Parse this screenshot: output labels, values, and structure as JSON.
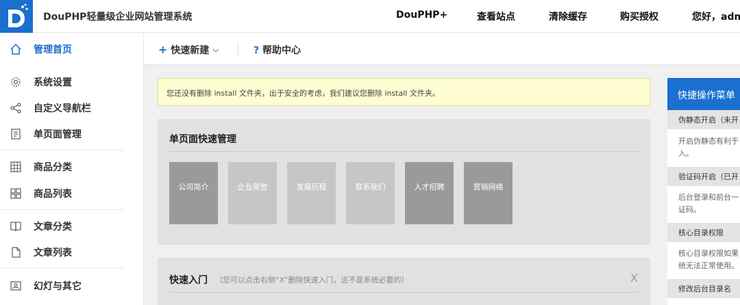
{
  "header": {
    "app_title": "DouPHP轻量级企业网站管理系统",
    "nav": [
      "DouPHP+",
      "查看站点",
      "清除缓存",
      "购买授权"
    ],
    "greeting": "您好，adm"
  },
  "sidebar": {
    "home": "管理首页",
    "items": [
      "系统设置",
      "自定义导航栏",
      "单页面管理",
      "商品分类",
      "商品列表",
      "文章分类",
      "文章列表",
      "幻灯与其它"
    ]
  },
  "toolbar": {
    "quick_new": "快速新建",
    "help": "帮助中心"
  },
  "notice": "您还没有删除 install 文件夹，出于安全的考虑，我们建议您删除 install 文件夹。",
  "single_pages": {
    "title": "单页面快速管理",
    "tiles": [
      "公司简介",
      "企业荣誉",
      "发展历程",
      "联系我们",
      "人才招聘",
      "营销网络"
    ]
  },
  "quick_entry": {
    "title": "快速入门",
    "hint": "（您可以点击右侧“X”删除快速入门，这不是系统必要的）",
    "close": "X"
  },
  "quick_menu": {
    "title": "快捷操作菜单",
    "items": [
      {
        "label": "伪静态开启（未开",
        "desc": "开启伪静态有利于入。"
      },
      {
        "label": "验证码开启（已开",
        "desc": "后台登录和前台一证码。"
      },
      {
        "label": "核心目录权限",
        "desc": "核心目录权限如果统无法正常使用。"
      },
      {
        "label": "修改后台目录名",
        "desc": ""
      }
    ]
  },
  "colors": {
    "accent": "#1a6fcf",
    "notice_bg": "#fefed2",
    "panel_bg": "#e1e1e1",
    "tile_dark": "#9a9a9a",
    "tile_light": "#c6c6c6"
  }
}
